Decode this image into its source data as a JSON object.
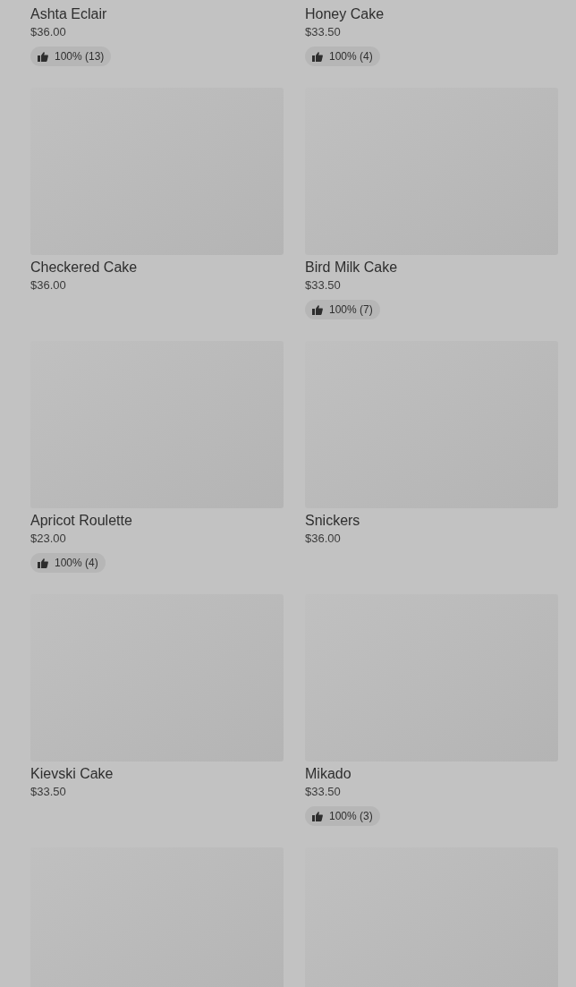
{
  "products": [
    {
      "name": "Ashta Eclair",
      "price": "$36.00",
      "rating": "100% (13)"
    },
    {
      "name": "Honey Cake",
      "price": "$33.50",
      "rating": "100% (4)"
    },
    {
      "picture": {
        "kind": "picture"
      },
      "name": "Checkered Cake",
      "price": "$36.00"
    },
    {
      "picture": {
        "kind": "picture"
      },
      "name": "Bird Milk Cake",
      "price": "$33.50",
      "rating": "100% (7)"
    },
    {
      "picture": {
        "kind": "picture"
      },
      "name": "Apricot Roulette",
      "price": "$23.00",
      "rating": "100% (4)"
    },
    {
      "picture": {
        "kind": "picture"
      },
      "name": "Snickers",
      "price": "$36.00"
    },
    {
      "picture": {
        "kind": "picture"
      },
      "name": "Kievski Cake",
      "price": "$33.50"
    },
    {
      "picture": {
        "kind": "picture"
      },
      "name": "Mikado",
      "price": "$33.50",
      "rating": "100% (3)"
    },
    {
      "picture": {
        "kind": "picture"
      }
    },
    {
      "picture": {
        "kind": "picture"
      }
    }
  ]
}
